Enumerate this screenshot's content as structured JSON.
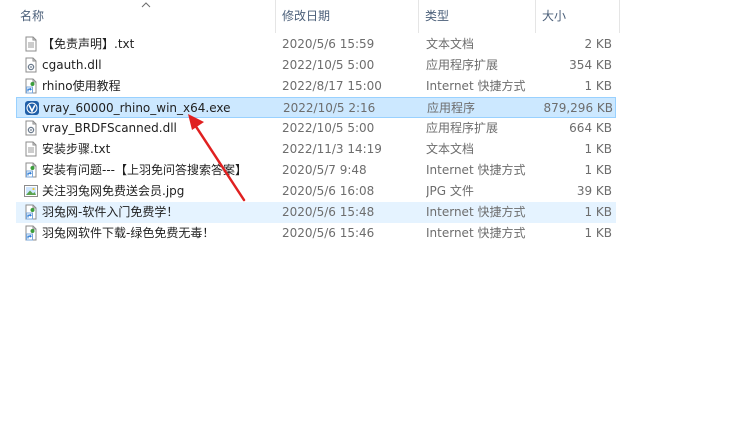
{
  "columns": {
    "name": "名称",
    "date": "修改日期",
    "type": "类型",
    "size": "大小"
  },
  "files": [
    {
      "name": "【免责声明】.txt",
      "date": "2020/5/6 15:59",
      "type": "文本文档",
      "size": "2 KB",
      "icon": "text-file-icon"
    },
    {
      "name": "cgauth.dll",
      "date": "2022/10/5 5:00",
      "type": "应用程序扩展",
      "size": "354 KB",
      "icon": "dll-file-icon"
    },
    {
      "name": "rhino使用教程",
      "date": "2022/8/17 15:00",
      "type": "Internet 快捷方式",
      "size": "1 KB",
      "icon": "internet-shortcut-icon"
    },
    {
      "name": "vray_60000_rhino_win_x64.exe",
      "date": "2022/10/5 2:16",
      "type": "应用程序",
      "size": "879,296 KB",
      "icon": "vray-app-icon"
    },
    {
      "name": "vray_BRDFScanned.dll",
      "date": "2022/10/5 5:00",
      "type": "应用程序扩展",
      "size": "664 KB",
      "icon": "dll-file-icon"
    },
    {
      "name": "安装步骤.txt",
      "date": "2022/11/3 14:19",
      "type": "文本文档",
      "size": "1 KB",
      "icon": "text-file-icon"
    },
    {
      "name": "安装有问题---【上羽免问答搜索答案】",
      "date": "2020/5/7 9:48",
      "type": "Internet 快捷方式",
      "size": "1 KB",
      "icon": "internet-shortcut-icon"
    },
    {
      "name": "关注羽兔网免费送会员.jpg",
      "date": "2020/5/6 16:08",
      "type": "JPG 文件",
      "size": "39 KB",
      "icon": "image-file-icon"
    },
    {
      "name": "羽兔网-软件入门免费学！",
      "date": "2020/5/6 15:48",
      "type": "Internet 快捷方式",
      "size": "1 KB",
      "icon": "internet-shortcut-icon"
    },
    {
      "name": "羽兔网软件下载-绿色免费无毒！",
      "date": "2020/5/6 15:46",
      "type": "Internet 快捷方式",
      "size": "1 KB",
      "icon": "internet-shortcut-icon"
    }
  ],
  "selected_index": 3,
  "hover_index": 8,
  "colors": {
    "selection_bg": "#cce8ff",
    "selection_border": "#99d1ff",
    "hover_bg": "#e5f3ff",
    "annotation_arrow": "#e02020"
  }
}
